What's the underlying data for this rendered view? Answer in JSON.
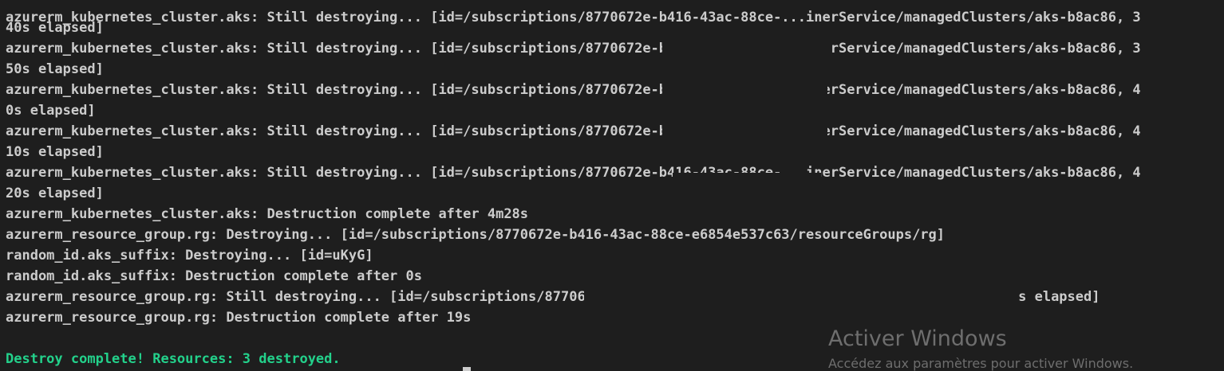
{
  "terminal": {
    "lines": [
      "azurerm_kubernetes_cluster.aks: Still destroying... [id=/subscriptions/8770672e-b416-43ac-88ce-...inerService/managedClusters/aks-b8ac86, 3",
      "40s elapsed]",
      "azurerm_kubernetes_cluster.aks: Still destroying... [id=/subscriptions/8770672e-b416-43ac-88ce-...inerService/managedClusters/aks-b8ac86, 3",
      "50s elapsed]",
      "azurerm_kubernetes_cluster.aks: Still destroying... [id=/subscriptions/8770672e-b416-43ac-88ce-...inerService/managedClusters/aks-b8ac86, 4",
      "0s elapsed]",
      "azurerm_kubernetes_cluster.aks: Still destroying... [id=/subscriptions/8770672e-b416-43ac-88ce-...inerService/managedClusters/aks-b8ac86, 4",
      "10s elapsed]",
      "azurerm_kubernetes_cluster.aks: Still destroying... [id=/subscriptions/8770672e-b416-43ac-88ce-...inerService/managedClusters/aks-b8ac86, 4",
      "20s elapsed]",
      "azurerm_kubernetes_cluster.aks: Destruction complete after 4m28s",
      "azurerm_resource_group.rg: Destroying... [id=/subscriptions/8770672e-b416-43ac-88ce-e6854e537c63/resourceGroups/rg]",
      "random_id.aks_suffix: Destroying... [id=uKyG]",
      "random_id.aks_suffix: Destruction complete after 0s",
      "azurerm_resource_group.rg: Still destroying... [id=/subscriptions/8770672e-b416-43ac-88ce-e6854e537c63/resourceGroups/rg, 10s elapsed]",
      "azurerm_resource_group.rg: Destruction complete after 19s",
      "",
      "Destroy complete! Resources: 3 destroyed."
    ]
  },
  "watermark": {
    "title": "Activer Windows",
    "subtitle": "Accédez aux paramètres pour activer Windows."
  },
  "colors": {
    "background": "#1e1e1e",
    "text": "#cccccc",
    "success": "#23d18b",
    "watermark": "#6e6e6e"
  }
}
